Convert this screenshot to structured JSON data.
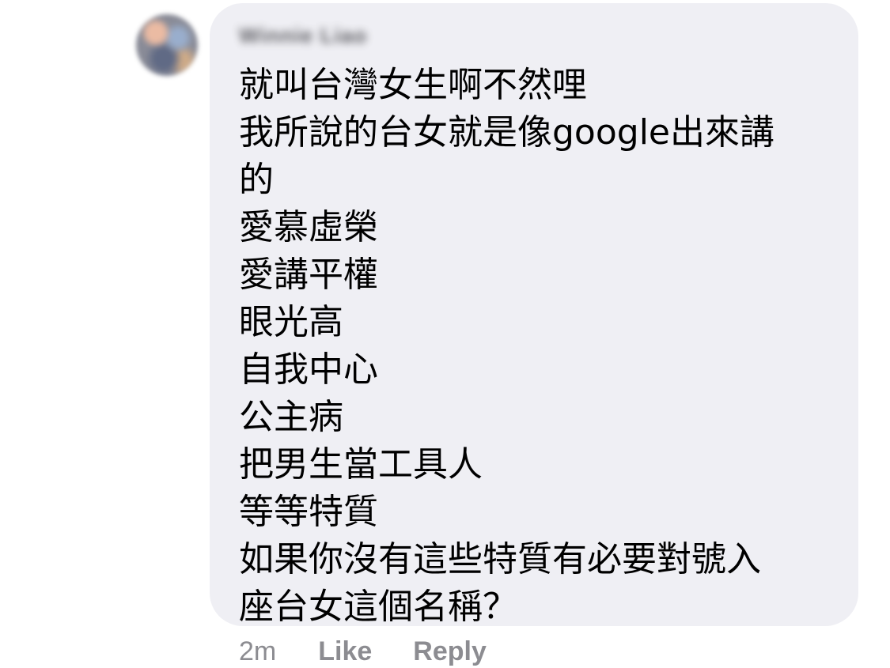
{
  "comment": {
    "author": "Winnie Liao",
    "lines": [
      "就叫台灣女生啊不然哩",
      "我所說的台女就是像google出來講",
      "的",
      "愛慕虛榮",
      "愛講平權",
      "眼光高",
      "自我中心",
      "公主病",
      "把男生當工具人",
      "等等特質",
      "如果你沒有這些特質有必要對號入",
      "座台女這個名稱？"
    ],
    "timestamp": "2m",
    "actions": {
      "like_label": "Like",
      "reply_label": "Reply"
    }
  },
  "colors": {
    "bubble_background": "#efeff4",
    "text": "#000000",
    "meta_text": "#8c8c91"
  }
}
